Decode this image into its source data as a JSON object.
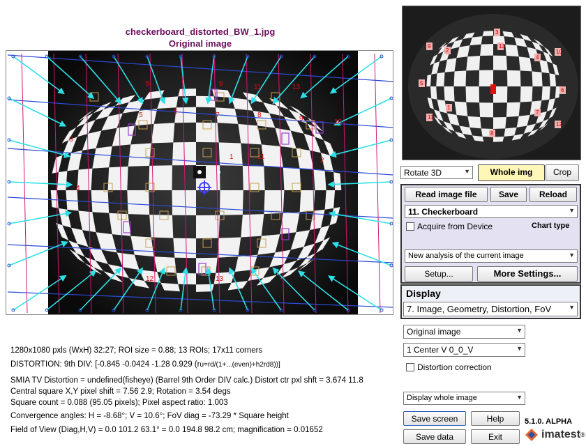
{
  "title": {
    "filename": "checkerboard_distorted_BW_1.jpg",
    "subtitle": "Original image"
  },
  "thumbnail": {
    "roi_labels": [
      "2",
      "3",
      "4",
      "5",
      "6",
      "7",
      "1",
      "8",
      "9",
      "10",
      "11",
      "12",
      "13"
    ]
  },
  "main_roi_labels": [
    "5",
    "7",
    "9",
    "11",
    "13",
    "5",
    "6",
    "7",
    "8",
    "9",
    "10",
    "11",
    "4",
    "3",
    "2",
    "1",
    "12",
    "13"
  ],
  "info": {
    "line1": "1280x1080 pxls (WxH) 32:27;    ROI size = 0.88;   13 ROIs;   17x11 corners",
    "line2": "DISTORTION:  9th DIV: [-0.845  -0.0424  -1.28  0.929  (r",
    "line2_formula": "u=rd/(1+...(even)+h2rd8))]",
    "line3": "SMIA TV Distortion = undefined(fisheye)  (Barrel   9th Order DIV calc.)  Distort ctr pxl shft = 3.674  11.8",
    "line4": "Central square X,Y pixel shift = 7.56  2.9;    Rotation = 3.54 degs",
    "line5": "Square count = 0.088  (95.05 pixels);  Pixel aspect ratio: 1.003",
    "line6": "Convergence angles:  H = -8.68°;  V = 10.6°;   FoV diag = -73.29 * Square height",
    "line7": "Field of View (Diag,H,V) =  0.0  101.2  63.1°  =  0.0   194.8  98.2 cm;  magnification = 0.01652"
  },
  "controls": {
    "rotate_select": "Rotate 3D",
    "whole_img_button": "Whole img",
    "crop_button": "Crop",
    "read_image_button": "Read image file",
    "save_button": "Save",
    "reload_button": "Reload",
    "chart_select": "11. Checkerboard",
    "acquire_label": "Acquire from Device",
    "chart_type_label": "Chart type",
    "analysis_select": "New analysis of the current image",
    "setup_button": "Setup...",
    "more_settings_button": "More Settings...",
    "display_title": "Display",
    "display_select": "7. Image, Geometry, Distortion, FoV",
    "image_select": "Original image",
    "center_select": "1  Center  V      0_0_V",
    "distortion_correction_label": "Distortion correction",
    "display_whole_select": "Display whole image",
    "save_screen_button": "Save screen",
    "help_button": "Help",
    "save_data_button": "Save data",
    "exit_button": "Exit",
    "version": "5.1.0. ALPHA",
    "logo_text": "imatest"
  },
  "colors": {
    "title": "#6a0f5c",
    "arrows": "#2de0e8",
    "grid_lines": "#2a4bd8",
    "vertical_lines": "#d4147a",
    "roi_boxes": "#c8a050",
    "roi_labels": "#e01010"
  }
}
